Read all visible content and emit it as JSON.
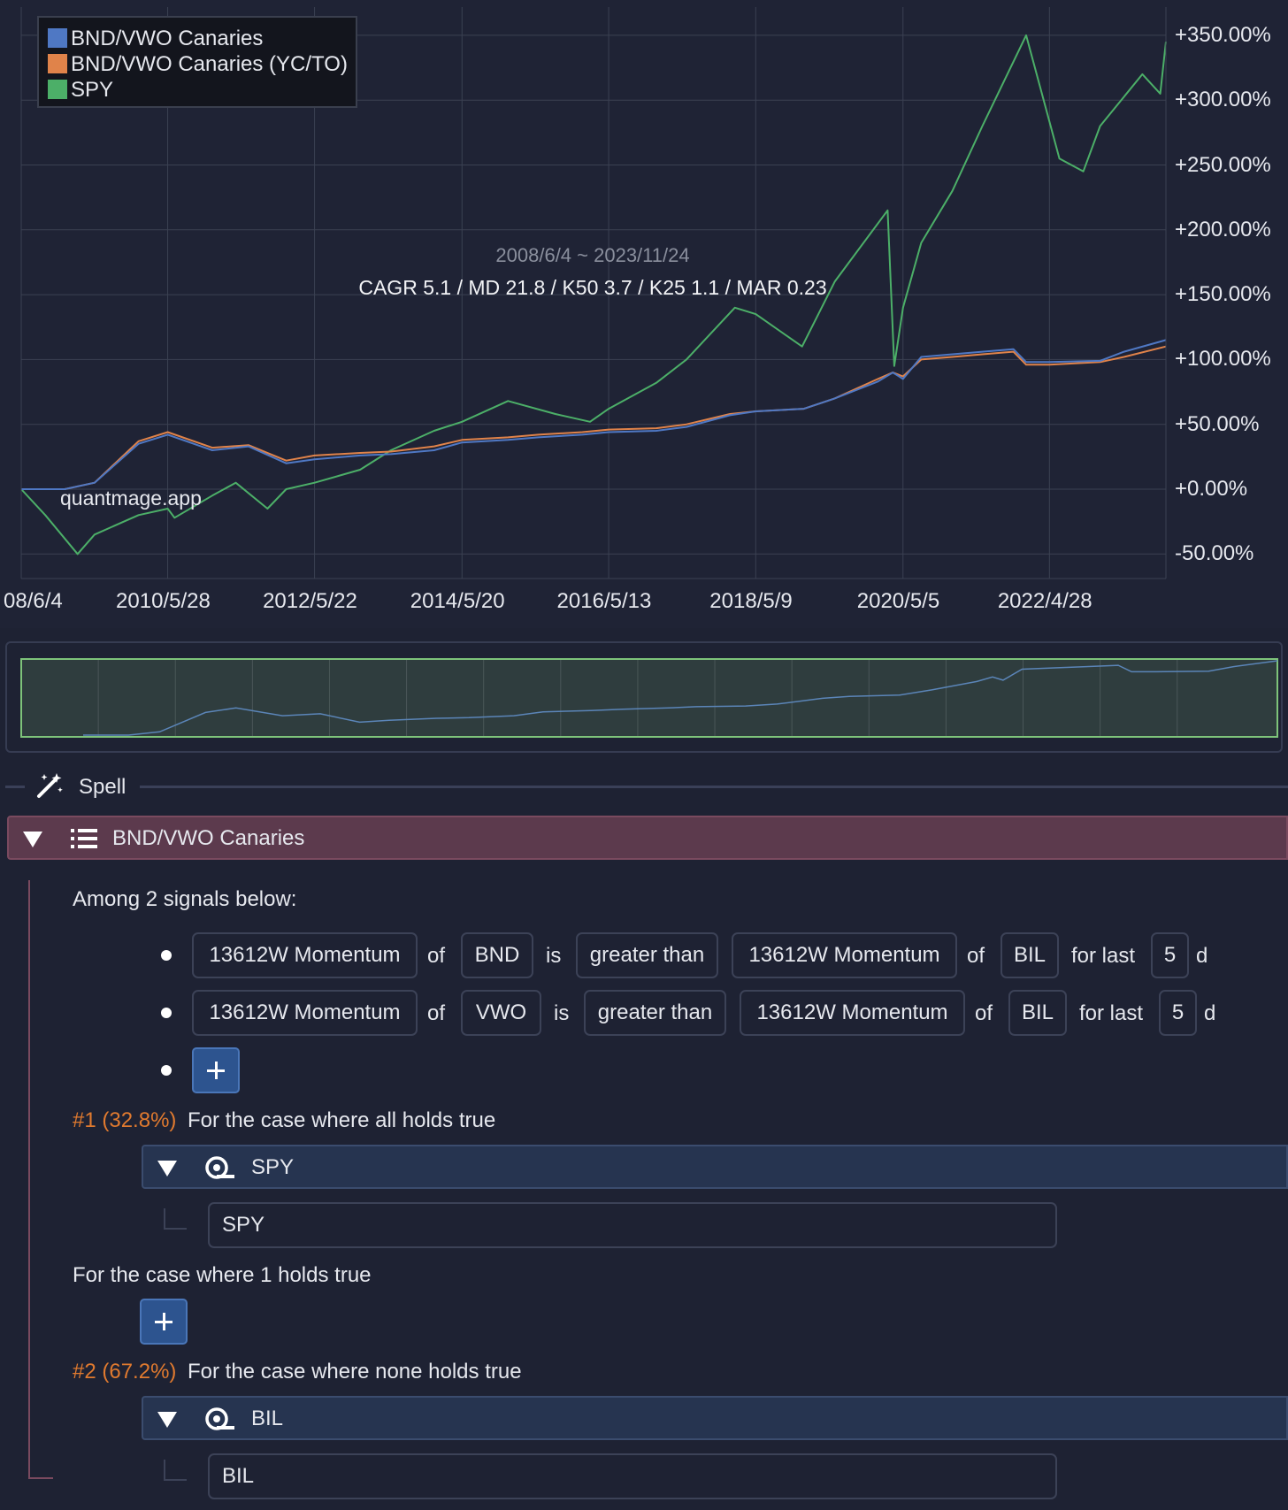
{
  "chart_data": {
    "type": "line",
    "legend": {
      "placement": "top-left"
    },
    "series": [
      {
        "name": "BND/VWO Canaries",
        "color": "#4f78c4",
        "x": [
          "2008/6/4",
          "2009/1/5",
          "2009/6/1",
          "2010/1/4",
          "2010/5/28",
          "2011/1/3",
          "2011/7/1",
          "2012/1/3",
          "2012/5/22",
          "2013/1/2",
          "2013/6/3",
          "2014/1/2",
          "2014/5/20",
          "2015/1/2",
          "2015/6/1",
          "2016/1/4",
          "2016/5/13",
          "2017/1/3",
          "2017/6/1",
          "2018/1/2",
          "2018/5/9",
          "2019/1/2",
          "2019/6/3",
          "2020/1/2",
          "2020/3/16",
          "2020/5/5",
          "2020/8/3",
          "2021/1/4",
          "2021/6/1",
          "2021/11/1",
          "2022/1/3",
          "2022/4/28",
          "2023/1/3",
          "2023/5/1",
          "2023/11/24"
        ],
        "y": [
          0,
          0,
          5,
          35,
          42,
          30,
          33,
          20,
          23,
          26,
          27,
          30,
          36,
          38,
          40,
          42,
          44,
          45,
          48,
          57,
          60,
          62,
          70,
          83,
          90,
          85,
          102,
          104,
          106,
          108,
          98,
          98,
          99,
          106,
          115
        ]
      },
      {
        "name": "BND/VWO Canaries (YC/TO)",
        "color": "#e0834a",
        "x": [
          "2008/6/4",
          "2009/1/5",
          "2009/6/1",
          "2010/1/4",
          "2010/5/28",
          "2011/1/3",
          "2011/7/1",
          "2012/1/3",
          "2012/5/22",
          "2013/1/2",
          "2013/6/3",
          "2014/1/2",
          "2014/5/20",
          "2015/1/2",
          "2015/6/1",
          "2016/1/4",
          "2016/5/13",
          "2017/1/3",
          "2017/6/1",
          "2018/1/2",
          "2018/5/9",
          "2019/1/2",
          "2019/6/3",
          "2020/1/2",
          "2020/3/16",
          "2020/5/5",
          "2020/8/3",
          "2021/1/4",
          "2021/6/1",
          "2021/11/1",
          "2022/1/3",
          "2022/4/28",
          "2023/1/3",
          "2023/5/1",
          "2023/11/24"
        ],
        "y": [
          0,
          0,
          5,
          37,
          44,
          32,
          34,
          22,
          26,
          28,
          29,
          33,
          38,
          40,
          42,
          44,
          46,
          47,
          50,
          58,
          60,
          62,
          70,
          85,
          90,
          87,
          100,
          102,
          104,
          106,
          96,
          96,
          98,
          102,
          110
        ]
      },
      {
        "name": "SPY",
        "color": "#4caf68",
        "x": [
          "2008/6/4",
          "2008/10/1",
          "2009/3/9",
          "2009/6/1",
          "2010/1/4",
          "2010/5/28",
          "2010/7/1",
          "2011/1/3",
          "2011/4/29",
          "2011/10/3",
          "2012/1/3",
          "2012/5/22",
          "2013/1/2",
          "2013/6/3",
          "2014/1/2",
          "2014/5/20",
          "2015/1/2",
          "2015/8/24",
          "2016/2/11",
          "2016/5/13",
          "2017/1/3",
          "2017/6/1",
          "2018/1/26",
          "2018/5/9",
          "2018/12/24",
          "2019/6/3",
          "2020/2/19",
          "2020/3/23",
          "2020/5/5",
          "2020/8/3",
          "2021/1/4",
          "2021/6/1",
          "2022/1/3",
          "2022/6/16",
          "2022/10/12",
          "2023/1/3",
          "2023/7/31",
          "2023/10/27",
          "2023/11/24"
        ],
        "y": [
          0,
          -20,
          -50,
          -35,
          -20,
          -15,
          -22,
          -5,
          5,
          -15,
          0,
          5,
          15,
          30,
          45,
          52,
          68,
          58,
          52,
          62,
          82,
          100,
          140,
          135,
          110,
          160,
          215,
          95,
          140,
          190,
          230,
          280,
          350,
          255,
          245,
          280,
          320,
          305,
          345
        ]
      }
    ],
    "y_ticks": [
      "+350.00%",
      "+300.00%",
      "+250.00%",
      "+200.00%",
      "+150.00%",
      "+100.00%",
      "+50.00%",
      "+0.00%",
      "-50.00%"
    ],
    "x_ticks": [
      "08/6/4",
      "2010/5/28",
      "2012/5/22",
      "2014/5/20",
      "2016/5/13",
      "2018/5/9",
      "2020/5/5",
      "2022/4/28"
    ],
    "ylim": [
      -60,
      370
    ],
    "date_range_label": "2008/6/4 ~ 2023/11/24",
    "stats_label": "CAGR 5.1 / MD 21.8 / K50 3.7 / K25 1.1 / MAR 0.23",
    "watermark": "quantmage.app",
    "grid": true
  },
  "spell": {
    "label": "Spell",
    "icon": "magic-wand-icon"
  },
  "node": {
    "title": "BND/VWO Canaries",
    "icon": "list-icon",
    "intro": "Among 2 signals below:",
    "signals": [
      {
        "left_indicator": "13612W Momentum",
        "of1": "of",
        "left_ticker": "BND",
        "is": "is",
        "comparator": "greater than",
        "right_indicator": "13612W Momentum",
        "of2": "of",
        "right_ticker": "BIL",
        "for_last": "for last",
        "days": "5",
        "unit": "d"
      },
      {
        "left_indicator": "13612W Momentum",
        "of1": "of",
        "left_ticker": "VWO",
        "is": "is",
        "comparator": "greater than",
        "right_indicator": "13612W Momentum",
        "of2": "of",
        "right_ticker": "BIL",
        "for_last": "for last",
        "days": "5",
        "unit": "d"
      }
    ],
    "case1": {
      "tag": "#1 (32.8%)",
      "label": "For the case where all holds true",
      "asset_header": "SPY",
      "asset": "SPY",
      "icon": "asset-icon"
    },
    "case_mid": {
      "label": "For the case where 1 holds true"
    },
    "case2": {
      "tag": "#2 (67.2%)",
      "label": "For the case where none holds true",
      "asset_header": "BIL",
      "asset": "BIL",
      "icon": "asset-icon"
    }
  }
}
